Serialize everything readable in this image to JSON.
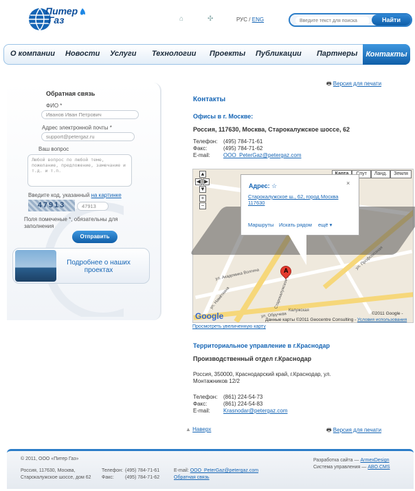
{
  "header": {
    "logo_line1": "Питер",
    "logo_line2": "Газ",
    "home_icon": "⌂",
    "sitemap_icon": "✣",
    "lang_ru": "РУС",
    "lang_sep": "/",
    "lang_en": "ENG",
    "search_placeholder": "Введите текст для поиска",
    "search_button": "Найти"
  },
  "nav": {
    "items": [
      "О компании",
      "Новости",
      "Услуги",
      "Технологии",
      "Проекты",
      "Публикации",
      "Партнеры"
    ],
    "active": "Контакты"
  },
  "feedback": {
    "title": "Обратная связь",
    "fio_label": "ФИО *",
    "fio_placeholder": "Иванов Иван Петрович",
    "email_label": "Адрес электронной почты *",
    "email_placeholder": "support@petergaz.ru",
    "question_label": "Ваш вопрос",
    "question_placeholder": "Любой вопрос по любой теме, пожелание, предложение, замечание и т.д. и т.п.",
    "code_label": "Введите код, указанный",
    "code_link": "на картинке",
    "captcha_text": "47913",
    "code_value": "47913",
    "required_note": "Поля помеченые *, обязательны для заполнения",
    "send_button": "Отправить"
  },
  "promo": {
    "text": "Подробнее о наших проектах"
  },
  "content": {
    "print_link": "Версия для печати",
    "title": "Контакты",
    "moscow_heading": "Офисы в г. Москве:",
    "moscow_address": "Россия, 117630, Москва, Старокалужское шоссе, 62",
    "phone_label": "Телефон:",
    "phone": "(495) 784-71-61",
    "fax_label": "Факс:",
    "fax": "(495) 784-71-62",
    "email_label": "E-mail:",
    "email": "OOO_PeterGaz@petergaz.com",
    "map_link": "Просмотреть увеличенную карту",
    "krasnodar_heading": "Территориальное управление в г.Краснодар",
    "krasnodar_dept": "Производственный отдел г.Краснодар",
    "krasnodar_address": "Россия, 350000, Краснодарский край, г.Краснодар, ул. Монтажников 12/2",
    "kr_phone": "(861) 224-54-73",
    "kr_fax": "(861) 224-54-83",
    "kr_email": "Krasnodar@petergaz.com",
    "up_link": "Наверх"
  },
  "map": {
    "types": [
      "Карта",
      "Спут",
      "Ланд.",
      "Земля"
    ],
    "popup_title": "Адрес:",
    "popup_address": "Старокалужское ш., 62, город Москва 117630",
    "popup_links": [
      "Маршруты",
      "Искать рядом",
      "ещё ▾"
    ],
    "marker_label": "A",
    "copyright": "©2011 Google -",
    "data_credit": "Данные карты ©2011 Geocentre Consulting -",
    "terms": "Условия использования",
    "google_logo": "Google",
    "street_labels": [
      "ул. Обручева",
      "Старокалужское ш.",
      "ул. Академика Волгина",
      "ул. Намёткина",
      "Калужская",
      "ул. Профсоюзная"
    ]
  },
  "footer": {
    "copyright": "© 2011, ООО «Питер Газ»",
    "addr1": "Россия, 117630, Москва,",
    "addr2": "Старокалужское шоссе, дом 62",
    "phone_label": "Телефон:",
    "phone": "(495) 784-71-61",
    "fax_label": "Факс:",
    "fax": "(495) 784-71-62",
    "email_label": "E-mail:",
    "email": "OOO_PeterGaz@petergaz.com",
    "feedback_link": "Обратная связь",
    "dev_label": "Разработка сайта —",
    "dev_link": "ArmexDesign",
    "cms_label": "Система управления —",
    "cms_link": "ABO.CMS"
  }
}
